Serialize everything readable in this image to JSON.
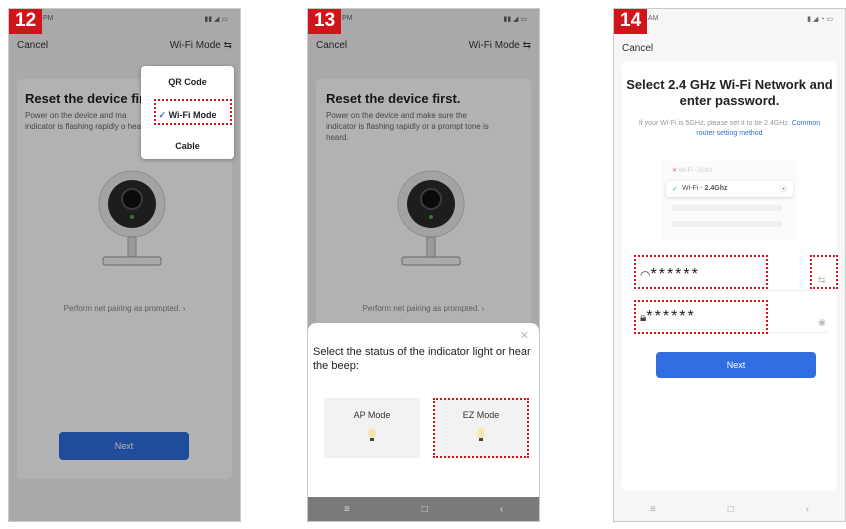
{
  "common": {
    "cancel": "Cancel",
    "next": "Next"
  },
  "panel12": {
    "step": "12",
    "status_time": "PM",
    "mode_label": "Wi-Fi Mode",
    "title": "Reset the device fir",
    "description": "Power on the device and ma indicator is flashing rapidly o heard.",
    "prompt": "Perform net pairing as prompted.",
    "menu": [
      "QR Code",
      "Wi-Fi Mode",
      "Cable"
    ]
  },
  "panel13": {
    "step": "13",
    "status_time": "PM",
    "mode_label": "Wi-Fi Mode",
    "title": "Reset the device first.",
    "description": "Power on the device and make sure the indicator is flashing rapidly or a prompt tone is heard.",
    "prompt": "Perform net pairing as prompted.",
    "sheet_title": "Select the status of the indicator light or hear the beep:",
    "options": [
      "AP Mode",
      "EZ Mode"
    ]
  },
  "panel14": {
    "step": "14",
    "status_time": "AM",
    "title": "Select 2.4 GHz Wi-Fi Network and enter password.",
    "subtitle": "If your Wi-Fi is 5GHz, please set it to be 2.4GHz.",
    "link": "Common router setting method",
    "wifi_5g": "Wi-Fi - 5Ghz",
    "wifi_24g_prefix": "Wi-Fi - ",
    "wifi_24g_band": "2.4Ghz",
    "ssid_value": "******",
    "password_value": "******"
  },
  "colors": {
    "step_badge": "#d0141a",
    "primary": "#2f6de0",
    "highlight": "#d0141a"
  }
}
